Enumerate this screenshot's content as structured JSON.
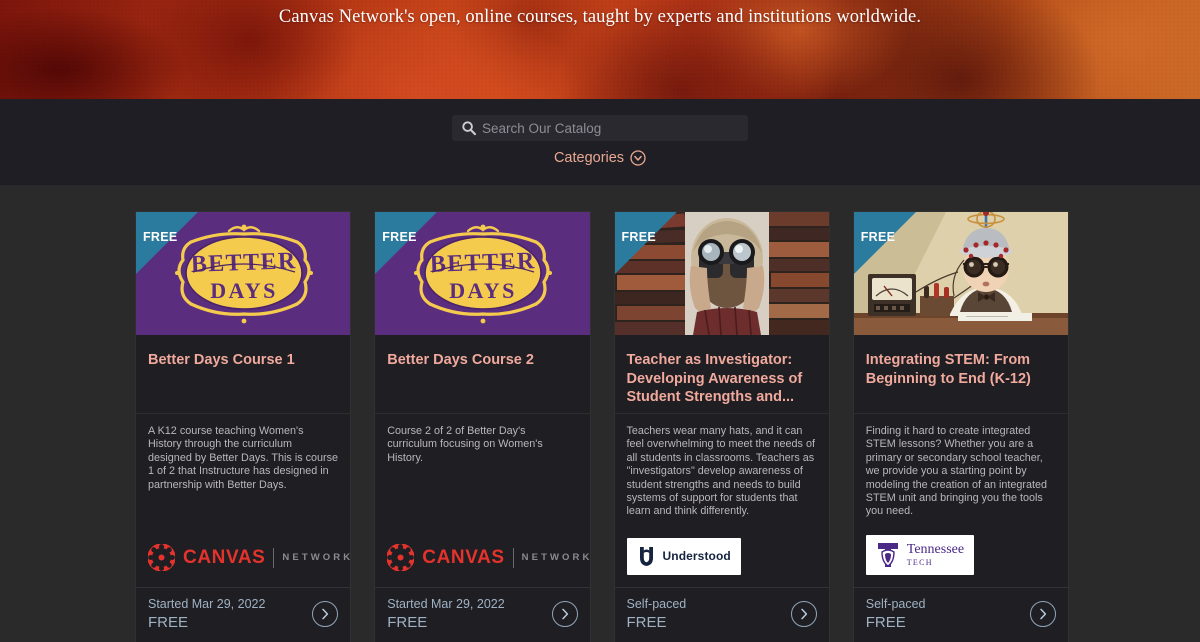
{
  "hero": {
    "tagline": "Canvas Network's open, online courses, taught by experts and institutions worldwide."
  },
  "search": {
    "placeholder": "Search Our Catalog",
    "value": "",
    "icon": "search-icon",
    "categories_label": "Categories",
    "categories_icon": "chevron-down-circle-icon"
  },
  "theme": {
    "page_background": "#2a2a2a",
    "searchbar_background": "#201e25",
    "card_background": "#1f1e23",
    "title_color": "#f0a99c",
    "accent_color": "#e8a892",
    "footer_text_color": "#9fb2c4",
    "ribbon_color": "#2b7b9e",
    "canvas_red": "#e4332c",
    "betterdays_purple": "#5b2d7e",
    "betterdays_gold": "#f5cb4e",
    "tennessee_purple": "#4b2a87",
    "understood_navy": "#15233f"
  },
  "cards": [
    {
      "badge": "FREE",
      "image_alt": "better-days-logo-artwork",
      "title": "Better Days Course 1",
      "description": "A K12 course teaching Women's History through the curriculum designed by Better Days. This is course 1 of 2 that Instructure has designed in partnership with Better Days.",
      "provider": "Canvas Network",
      "provider_logo": "canvas-network-logo",
      "provider_primary": "CANVAS",
      "provider_secondary": "NETWORK",
      "schedule": "Started Mar 29, 2022",
      "price": "FREE",
      "action_icon": "chevron-right-circle-icon"
    },
    {
      "badge": "FREE",
      "image_alt": "better-days-logo-artwork",
      "title": "Better Days Course 2",
      "description": "Course 2 of 2 of Better Day's curriculum focusing on Women's History.",
      "provider": "Canvas Network",
      "provider_logo": "canvas-network-logo",
      "provider_primary": "CANVAS",
      "provider_secondary": "NETWORK",
      "schedule": "Started Mar 29, 2022",
      "price": "FREE",
      "action_icon": "chevron-right-circle-icon"
    },
    {
      "badge": "FREE",
      "image_alt": "person-with-binoculars-among-books-photo",
      "title": "Teacher as Investigator: Developing Awareness of Student Strengths and...",
      "description": "Teachers wear many hats, and it can feel overwhelming to meet the needs of all students in classrooms. Teachers as \"investigators\" develop awareness of student strengths and needs to build systems of support for students that learn and think differently.",
      "provider": "Understood",
      "provider_logo": "understood-logo",
      "provider_primary": "Understood",
      "provider_secondary": "",
      "schedule": "Self-paced",
      "price": "FREE",
      "action_icon": "chevron-right-circle-icon"
    },
    {
      "badge": "FREE",
      "image_alt": "child-scientist-with-helmet-and-goggles-photo",
      "title": "Integrating STEM: From Beginning to End (K-12)",
      "description": "Finding it hard to create integrated STEM lessons? Whether you are a primary or secondary school teacher, we provide you a starting point by modeling the creation of an integrated STEM unit and bringing you the tools you need.",
      "provider": "Tennessee Tech",
      "provider_logo": "tennessee-tech-logo",
      "provider_primary": "Tennessee",
      "provider_secondary": "TECH",
      "schedule": "Self-paced",
      "price": "FREE",
      "action_icon": "chevron-right-circle-icon"
    }
  ]
}
